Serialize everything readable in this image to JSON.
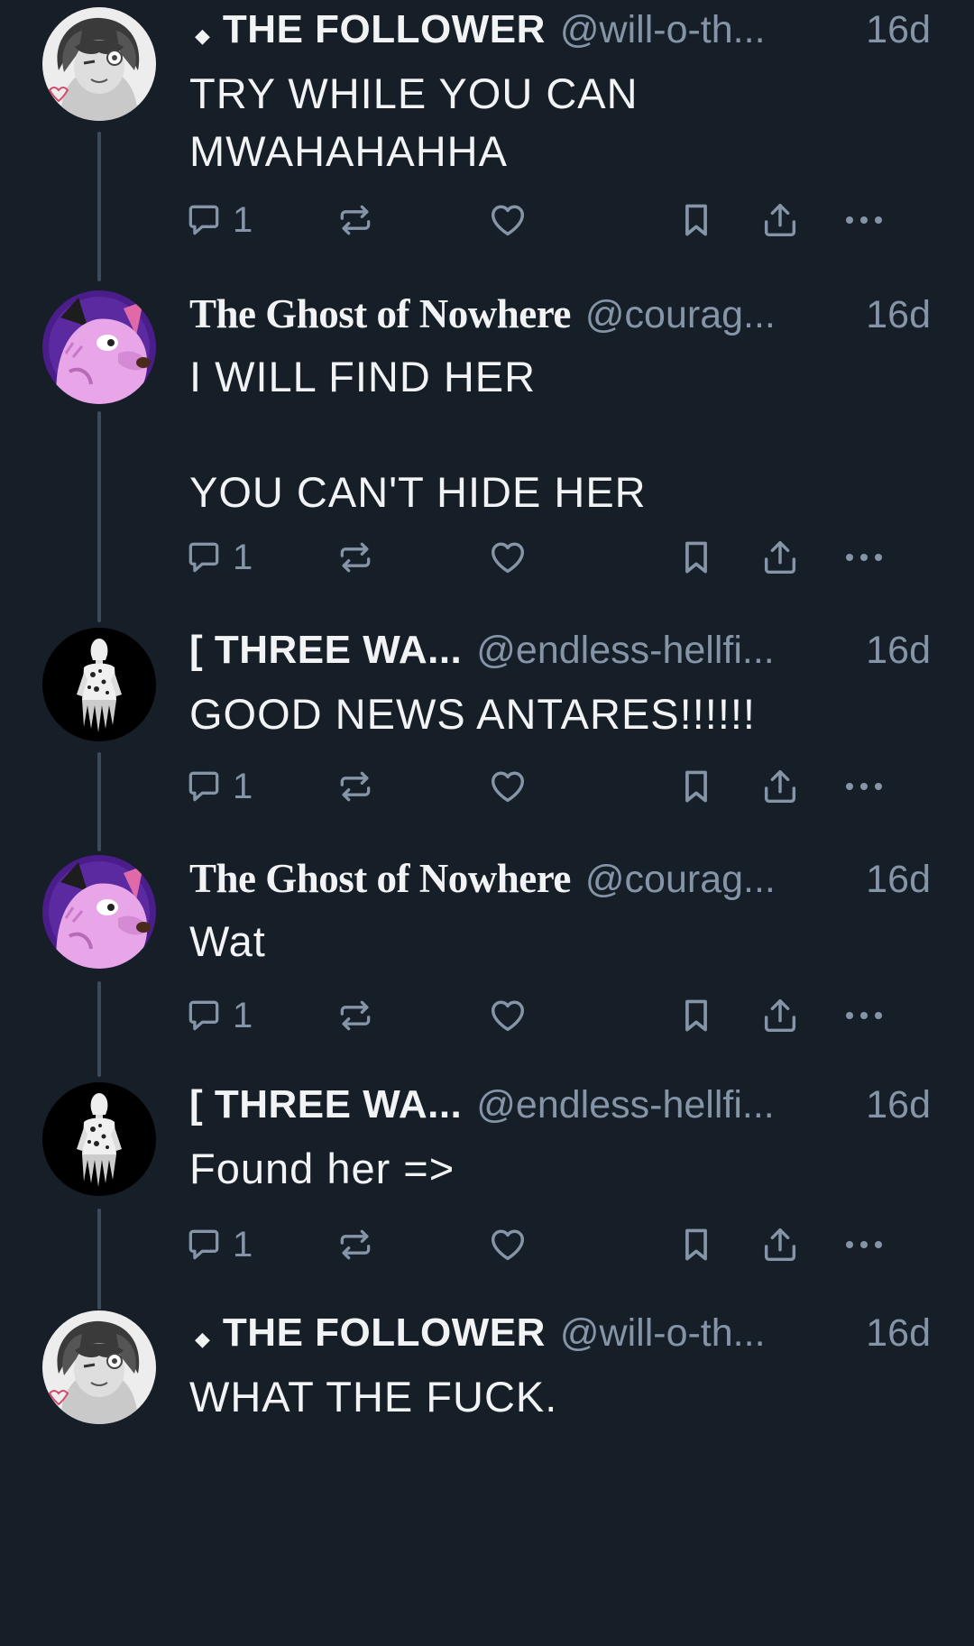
{
  "thread": {
    "posts": [
      {
        "author": "THE FOLLOWER",
        "badge": "◆",
        "handle": "@will-o-th...",
        "time": "16d",
        "avatar": "grey-haired-character-avatar",
        "text": [
          "TRY WHILE YOU CAN",
          "MWAHAHAHHA"
        ],
        "reply_count": "1"
      },
      {
        "author": "The Ghost of Nowhere",
        "handle": "@courag...",
        "time": "16d",
        "avatar": "pink-dog-avatar",
        "text": [
          "I WILL FIND HER",
          "",
          "YOU CAN'T HIDE HER"
        ],
        "reply_count": "1"
      },
      {
        "author": "[ THREE WA...",
        "handle": "@endless-hellfi...",
        "time": "16d",
        "avatar": "dark-ghost-figure-avatar",
        "text": [
          "GOOD NEWS ANTARES!!!!!!"
        ],
        "reply_count": "1"
      },
      {
        "author": "The Ghost of Nowhere",
        "handle": "@courag...",
        "time": "16d",
        "avatar": "pink-dog-avatar",
        "text": [
          "Wat"
        ],
        "reply_count": "1"
      },
      {
        "author": "[ THREE WA...",
        "handle": "@endless-hellfi...",
        "time": "16d",
        "avatar": "dark-ghost-figure-avatar",
        "text": [
          "Found her =>"
        ],
        "reply_count": "1"
      },
      {
        "author": "THE FOLLOWER",
        "badge": "◆",
        "handle": "@will-o-th...",
        "time": "16d",
        "avatar": "grey-haired-character-avatar",
        "text": [
          "WHAT THE FUCK."
        ],
        "reply_count": ""
      }
    ],
    "action_icons": [
      "reply-icon",
      "repost-icon",
      "like-icon",
      "bookmark-icon",
      "share-icon",
      "more-icon"
    ]
  },
  "colors": {
    "background": "#161e27",
    "text": "#f1f3f5",
    "muted": "#8595a7",
    "thread_line": "#3c4b5c"
  }
}
